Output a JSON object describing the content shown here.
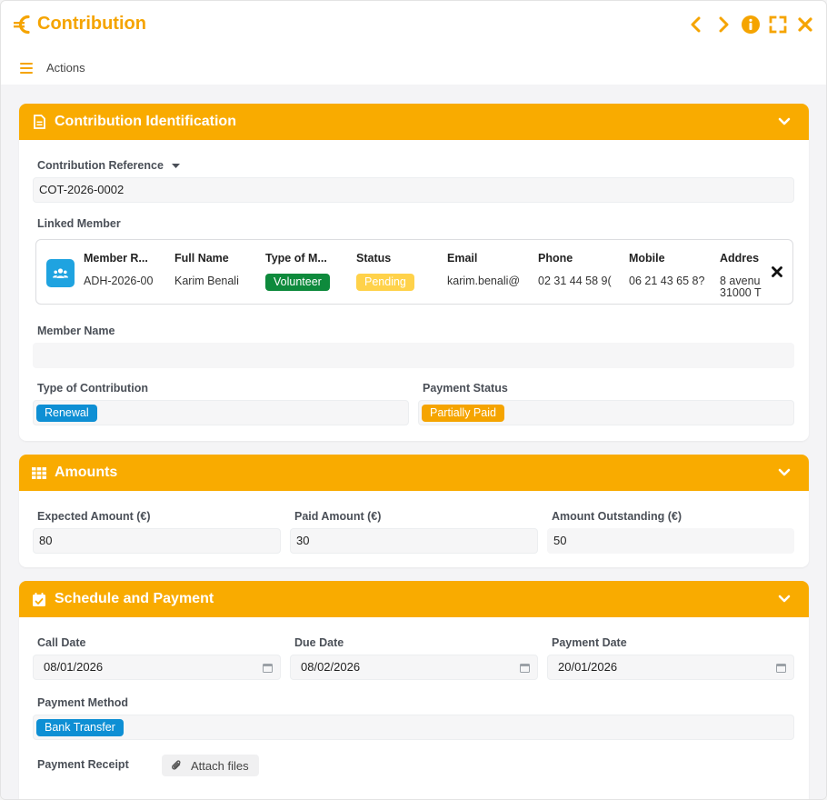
{
  "window": {
    "title": "Contribution",
    "accent": "#f9ab00",
    "icons": [
      "euro-icon",
      "chevron-left-icon",
      "chevron-right-icon",
      "info-icon",
      "fullscreen-icon",
      "close-icon"
    ]
  },
  "actions": {
    "label": "Actions"
  },
  "identification": {
    "header": "Contribution Identification",
    "reference_label": "Contribution Reference",
    "reference_value": "COT-2026-0002",
    "linked_member_label": "Linked Member",
    "linked_member": {
      "columns": [
        "Member R...",
        "Full Name",
        "Type of M...",
        "Status",
        "Email",
        "Phone",
        "Mobile",
        "Addres"
      ],
      "member_ref": "ADH-2026-00",
      "full_name": "Karim Benali",
      "type": "Volunteer",
      "status": "Pending",
      "email": "karim.benali@",
      "phone": "02 31 44 58 9(",
      "mobile": "06 21 43 65 8?",
      "address_line1": "8 avenu",
      "address_line2": "31000 T"
    },
    "member_name_label": "Member Name",
    "member_name_value": "",
    "type_label": "Type of Contribution",
    "type_value": "Renewal",
    "payment_status_label": "Payment Status",
    "payment_status_value": "Partially Paid"
  },
  "amounts": {
    "header": "Amounts",
    "expected_label": "Expected Amount (€)",
    "expected_value": "80",
    "paid_label": "Paid Amount (€)",
    "paid_value": "30",
    "outstanding_label": "Amount Outstanding (€)",
    "outstanding_value": "50"
  },
  "schedule": {
    "header": "Schedule and Payment",
    "call_date_label": "Call Date",
    "call_date_value": "08/01/2026",
    "due_date_label": "Due Date",
    "due_date_value": "08/02/2026",
    "payment_date_label": "Payment Date",
    "payment_date_value": "20/01/2026",
    "method_label": "Payment Method",
    "method_value": "Bank Transfer",
    "receipt_label": "Payment Receipt",
    "attach_label": "Attach files"
  },
  "colors": {
    "tag_blue": "#0e8fd4",
    "tag_orange": "#f5a400",
    "tag_green": "#0e8a3c",
    "tag_yellow": "#ffd24a"
  }
}
